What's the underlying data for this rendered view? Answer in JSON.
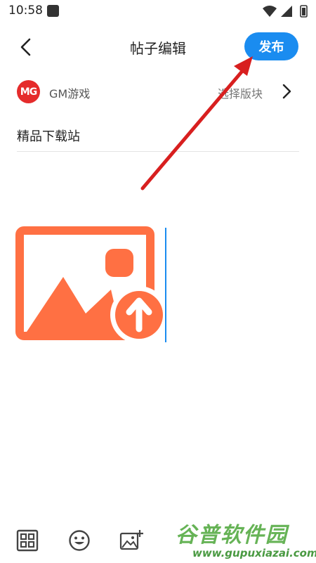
{
  "status_bar": {
    "time": "10:58",
    "icons": [
      "wifi-icon",
      "signal-icon",
      "battery-icon"
    ]
  },
  "header": {
    "title": "帖子编辑",
    "publish_label": "发布",
    "back_icon": "chevron-left-icon"
  },
  "section": {
    "logo_text": "MG",
    "name": "GM游戏",
    "select_label": "选择版块",
    "chevron_icon": "chevron-right-icon"
  },
  "post": {
    "title_value": "精品下载站",
    "image_icon": "image-upload-icon"
  },
  "toolbar": {
    "items": [
      "grid-icon",
      "emoji-icon",
      "add-image-icon"
    ]
  },
  "watermark": {
    "main_text": "谷普软件园",
    "url_text": "www.gupuxiazai.com"
  },
  "colors": {
    "accent": "#1a8cf0",
    "logo_red": "#e52b2b",
    "image_orange": "#ff7043",
    "arrow_red": "#d81f1f"
  }
}
